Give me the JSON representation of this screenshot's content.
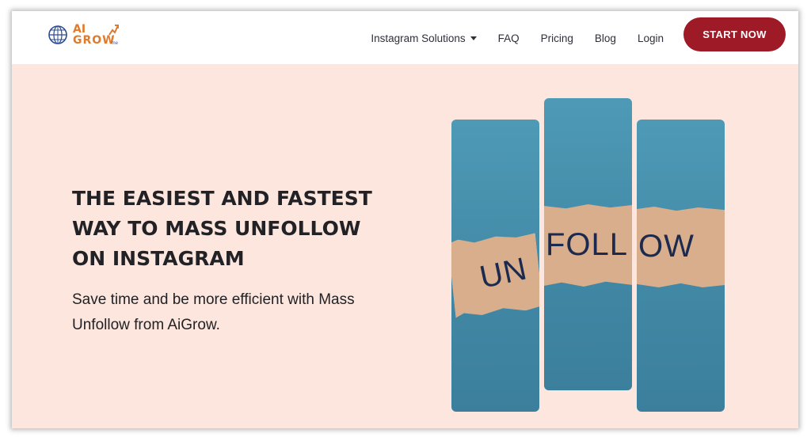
{
  "navbar": {
    "logo": {
      "text_top": "AI",
      "text_bottom": "GROW",
      "suffix": ".me"
    },
    "links": [
      {
        "label": "Instagram Solutions",
        "has_dropdown": true
      },
      {
        "label": "FAQ"
      },
      {
        "label": "Pricing"
      },
      {
        "label": "Blog"
      },
      {
        "label": "Login"
      }
    ],
    "cta_label": "START NOW"
  },
  "hero": {
    "headline_lines": [
      "THE EASIEST AND FASTEST",
      "WAY TO MASS UNFOLLOW",
      "ON INSTAGRAM"
    ],
    "subtitle_lines": [
      "Save time and be more efficient with Mass",
      "Unfollow from AiGrow."
    ],
    "image_text": {
      "left": "UN",
      "center": "FOLL",
      "right": "OW"
    }
  },
  "colors": {
    "hero_bg": "#fce6dd",
    "cta_bg": "#9e1a26",
    "panel_blue": "#4289a6",
    "paper": "#d8ae8c",
    "text_dark": "#222226"
  }
}
